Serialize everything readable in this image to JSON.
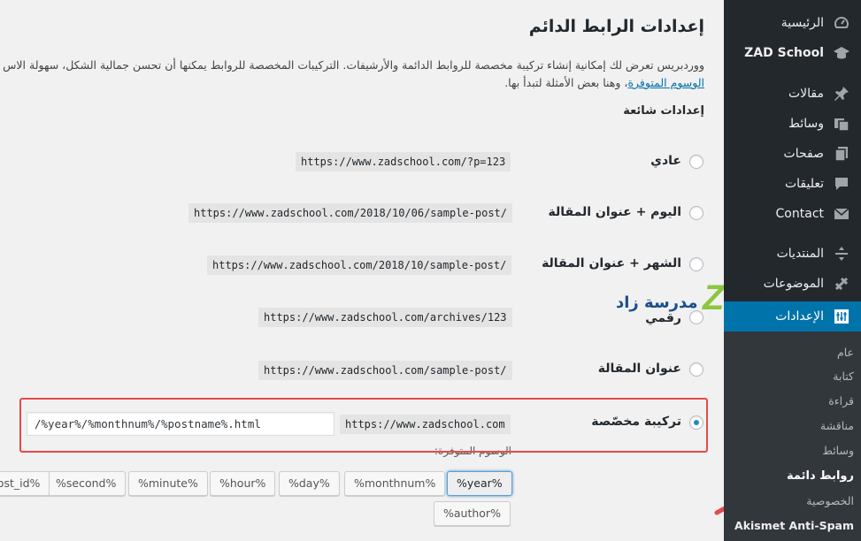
{
  "menu": {
    "items": [
      {
        "label": "الرئيسية",
        "icon": "dashboard-icon"
      },
      {
        "label": "ZAD School",
        "icon": "school-icon"
      },
      {
        "label": "مقالات",
        "icon": "pin-icon"
      },
      {
        "label": "وسائط",
        "icon": "media-icon"
      },
      {
        "label": "صفحات",
        "icon": "pages-icon"
      },
      {
        "label": "تعليقات",
        "icon": "comments-icon"
      },
      {
        "label": "Contact",
        "icon": "mail-icon"
      },
      {
        "label": "المنتديات",
        "icon": "forums-icon"
      },
      {
        "label": "الموضوعات",
        "icon": "topics-icon"
      },
      {
        "label": "الإعدادات",
        "icon": "settings-icon"
      }
    ],
    "submenu": [
      {
        "label": "عام"
      },
      {
        "label": "كتابة"
      },
      {
        "label": "قراءة"
      },
      {
        "label": "مناقشة"
      },
      {
        "label": "وسائط"
      },
      {
        "label": "روابط دائمة"
      },
      {
        "label": "الخصوصية"
      },
      {
        "label": "Akismet Anti-Spam"
      }
    ]
  },
  "page": {
    "title": "إعدادات الرابط الدائم",
    "intro_line1": "ووردبريس تعرض لك إمكانية إنشاء تركيبة مخصصة للروابط الدائمة والأرشيفات. التركيبات المخصصة للروابط يمكنها أن تحسن جمالية الشكل، سهولة الاس",
    "intro_link": "الوسوم المتوفرة",
    "intro_line2_rest": "، وهنا بعض الأمثلة لتبدأ بها.",
    "common_heading": "إعدادات شائعة",
    "options": [
      {
        "label": "عادي",
        "code": "https://www.zadschool.com/?p=123"
      },
      {
        "label": "اليوم + عنوان المقالة",
        "code": "https://www.zadschool.com/2018/10/06/sample-post/"
      },
      {
        "label": "الشهر + عنوان المقالة",
        "code": "https://www.zadschool.com/2018/10/sample-post/"
      },
      {
        "label": "رقمي",
        "code": "https://www.zadschool.com/archives/123"
      },
      {
        "label": "عنوان المقالة",
        "code": "https://www.zadschool.com/sample-post/"
      }
    ],
    "custom": {
      "label": "تركيبة مخصّصة",
      "base": "https://www.zadschool.com",
      "value": "/%year%/%monthnum%/%postname%.html"
    },
    "available_tags_label": "الوسوم المتوفرة:",
    "tags_row1": [
      "%year%",
      "%monthnum%",
      "%day%",
      "%hour%",
      "%minute%",
      "%second%",
      "%post_id%"
    ],
    "tags_row2": [
      "%author%"
    ]
  },
  "logo": {
    "text": "مدرسة زاد",
    "mark": "ZAD"
  },
  "colors": {
    "sidebar": "#23282d",
    "active": "#0073aa",
    "highlight": "#e44a4a"
  }
}
